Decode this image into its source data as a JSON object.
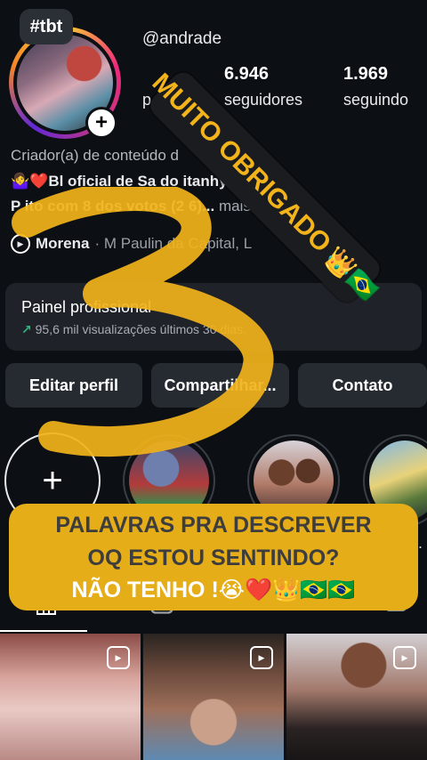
{
  "profile": {
    "tbt_badge": "#tbt",
    "username": "@andrade",
    "stats": [
      {
        "value": "",
        "label": "p"
      },
      {
        "value": "6.946",
        "label": "seguidores"
      },
      {
        "value": "1.969",
        "label": "seguindo"
      }
    ],
    "add_story_symbol": "+"
  },
  "bio": {
    "line1": "Criador(a) de conteúdo d",
    "line2": "🤷‍♀️❤️Bl       oficial de Sa          do itanhy",
    "line3": "P      ito com 8     dos votos (2             6)...",
    "more": "mais",
    "location_name": "Morena",
    "location_rest": "· M    Paulin da Capital, L"
  },
  "panel": {
    "title": "Painel profissional",
    "trend_icon": "↗",
    "subtitle": "95,6 mil visualizações     últimos 30 dias."
  },
  "buttons": {
    "edit": "Editar perfil",
    "share": "Compartilhar...",
    "contact": "Contato"
  },
  "highlights": {
    "new_symbol": "+",
    "more_dots": "...."
  },
  "tabs": {
    "grid_icon": "grid-icon",
    "reels_icon": "reels-icon",
    "tagged_icon": "tagged-icon"
  },
  "overlays": {
    "sticker_text": "MUITO OBRIGADO",
    "sticker_emoji": "👑🇧🇷",
    "caption_line1": "PALAVRAS PRA DESCREVER",
    "caption_line2": "OQ ESTOU SENTINDO?",
    "caption_line3": "NÃO TENHO !😭❤️👑🇧🇷🇧🇷",
    "scribble_number": "3"
  },
  "colors": {
    "background": "#0c0f14",
    "panel": "#1f2329",
    "button": "#262a31",
    "accent_yellow": "#e5ad18",
    "trend_green": "#2fb87b"
  }
}
